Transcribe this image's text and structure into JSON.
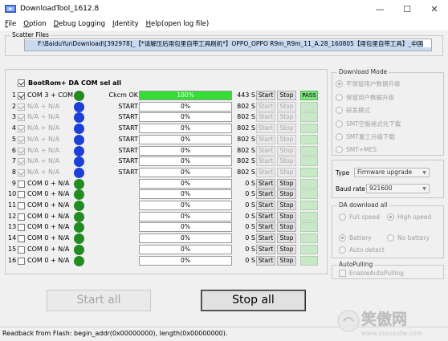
{
  "window": {
    "title": "DownloadTool_1612.8"
  },
  "menu": [
    {
      "label": "File",
      "key": "F"
    },
    {
      "label": "Option",
      "key": "O"
    },
    {
      "label": "Debug Logging",
      "key": "D"
    },
    {
      "label": "Identity",
      "key": "I"
    },
    {
      "label": "Help(open log file)",
      "key": "H"
    }
  ],
  "scatter": {
    "legend": "Scatter Files",
    "path_line1": "F:\\BaiduYunDownload\\[392978]_【*请解压后用包里自带工具刷机*】OPPO_OPPO R9m_R9m_11_A.28_160805【用包里自带工具】_中国",
    "path_line2": ""
  },
  "ports_header": {
    "label": "BootRom+ DA COM sel all",
    "checked": true
  },
  "ports": [
    {
      "num": "1",
      "checked": true,
      "disabled": false,
      "name": "COM 3 + COM 5",
      "led": "#228b22",
      "status": "Ckcm OK",
      "progress_label": "100%",
      "progress": 1.0,
      "time": "443 S",
      "start": "Start",
      "stop": "Stop",
      "btn_disabled": false,
      "result": "PASS"
    },
    {
      "num": "2",
      "checked": true,
      "disabled": true,
      "name": "N/A + N/A",
      "led": "#1c3fd8",
      "status": "START",
      "progress_label": "0%",
      "progress": 0,
      "time": "802 S",
      "start": "Start",
      "stop": "Stop",
      "btn_disabled": true,
      "result": ""
    },
    {
      "num": "3",
      "checked": true,
      "disabled": true,
      "name": "N/A + N/A",
      "led": "#1c3fd8",
      "status": "START",
      "progress_label": "0%",
      "progress": 0,
      "time": "802 S",
      "start": "Start",
      "stop": "Stop",
      "btn_disabled": true,
      "result": ""
    },
    {
      "num": "4",
      "checked": true,
      "disabled": true,
      "name": "N/A + N/A",
      "led": "#1c3fd8",
      "status": "START",
      "progress_label": "0%",
      "progress": 0,
      "time": "802 S",
      "start": "Start",
      "stop": "Stop",
      "btn_disabled": true,
      "result": ""
    },
    {
      "num": "5",
      "checked": true,
      "disabled": true,
      "name": "N/A + N/A",
      "led": "#1c3fd8",
      "status": "START",
      "progress_label": "0%",
      "progress": 0,
      "time": "802 S",
      "start": "Start",
      "stop": "Stop",
      "btn_disabled": true,
      "result": ""
    },
    {
      "num": "6",
      "checked": true,
      "disabled": true,
      "name": "N/A + N/A",
      "led": "#1c3fd8",
      "status": "START",
      "progress_label": "0%",
      "progress": 0,
      "time": "802 S",
      "start": "Start",
      "stop": "Stop",
      "btn_disabled": true,
      "result": ""
    },
    {
      "num": "7",
      "checked": true,
      "disabled": true,
      "name": "N/A + N/A",
      "led": "#1c3fd8",
      "status": "START",
      "progress_label": "0%",
      "progress": 0,
      "time": "802 S",
      "start": "Start",
      "stop": "Stop",
      "btn_disabled": true,
      "result": ""
    },
    {
      "num": "8",
      "checked": true,
      "disabled": true,
      "name": "N/A + N/A",
      "led": "#1c3fd8",
      "status": "START",
      "progress_label": "0%",
      "progress": 0,
      "time": "802 S",
      "start": "Start",
      "stop": "Stop",
      "btn_disabled": true,
      "result": ""
    },
    {
      "num": "9",
      "checked": false,
      "disabled": false,
      "name": "COM 0 + N/A",
      "led": "#228b22",
      "status": "",
      "progress_label": "0%",
      "progress": 0,
      "time": "0 S",
      "start": "Start",
      "stop": "Stop",
      "btn_disabled": false,
      "result": ""
    },
    {
      "num": "10",
      "checked": false,
      "disabled": false,
      "name": "COM 0 + N/A",
      "led": "#228b22",
      "status": "",
      "progress_label": "0%",
      "progress": 0,
      "time": "0 S",
      "start": "Start",
      "stop": "Stop",
      "btn_disabled": false,
      "result": ""
    },
    {
      "num": "11",
      "checked": false,
      "disabled": false,
      "name": "COM 0 + N/A",
      "led": "#228b22",
      "status": "",
      "progress_label": "0%",
      "progress": 0,
      "time": "0 S",
      "start": "Start",
      "stop": "Stop",
      "btn_disabled": false,
      "result": ""
    },
    {
      "num": "12",
      "checked": false,
      "disabled": false,
      "name": "COM 0 + N/A",
      "led": "#228b22",
      "status": "",
      "progress_label": "0%",
      "progress": 0,
      "time": "0 S",
      "start": "Start",
      "stop": "Stop",
      "btn_disabled": false,
      "result": ""
    },
    {
      "num": "13",
      "checked": false,
      "disabled": false,
      "name": "COM 0 + N/A",
      "led": "#228b22",
      "status": "",
      "progress_label": "0%",
      "progress": 0,
      "time": "0 S",
      "start": "Start",
      "stop": "Stop",
      "btn_disabled": false,
      "result": ""
    },
    {
      "num": "14",
      "checked": false,
      "disabled": false,
      "name": "COM 0 + N/A",
      "led": "#228b22",
      "status": "",
      "progress_label": "0%",
      "progress": 0,
      "time": "0 S",
      "start": "Start",
      "stop": "Stop",
      "btn_disabled": false,
      "result": ""
    },
    {
      "num": "15",
      "checked": false,
      "disabled": false,
      "name": "COM 0 + N/A",
      "led": "#228b22",
      "status": "",
      "progress_label": "0%",
      "progress": 0,
      "time": "0 S",
      "start": "Start",
      "stop": "Stop",
      "btn_disabled": false,
      "result": ""
    },
    {
      "num": "16",
      "checked": false,
      "disabled": false,
      "name": "COM 0 + N/A",
      "led": "#228b22",
      "status": "",
      "progress_label": "0%",
      "progress": 0,
      "time": "0 S",
      "start": "Start",
      "stop": "Stop",
      "btn_disabled": false,
      "result": ""
    }
  ],
  "download_mode": {
    "legend": "Download Mode",
    "options": [
      {
        "label": "不保留用户数据升级",
        "checked": true
      },
      {
        "label": "保留用户数据升级",
        "checked": false
      },
      {
        "label": "研发模式",
        "checked": false
      },
      {
        "label": "SMT空板格式化下载",
        "checked": false
      },
      {
        "label": "SMT重工升级下载",
        "checked": false
      },
      {
        "label": "SMT+MES",
        "checked": false
      }
    ]
  },
  "type_box": {
    "type_label": "Type",
    "type_value": "Firmware upgrade",
    "baud_label": "Baud rate",
    "baud_value": "921600"
  },
  "da_download": {
    "legend": "DA download all",
    "full_speed": "Full speed",
    "high_speed": "High speed",
    "high_speed_checked": true,
    "battery": "Battery",
    "battery_checked": true,
    "no_battery": "No battery",
    "auto_detect": "Auto detect"
  },
  "autopulling": {
    "legend": "AutoPulling",
    "label": "EnableAutoPulling",
    "checked": false
  },
  "buttons": {
    "start_all": "Start all",
    "stop_all": "Stop all"
  },
  "statusbar": {
    "text": "Readback from Flash:  begin_addr(0x00000000), length(0x00000000)."
  },
  "watermark": {
    "text": "笑傲网",
    "url": "www.xiaoaotw.com"
  }
}
